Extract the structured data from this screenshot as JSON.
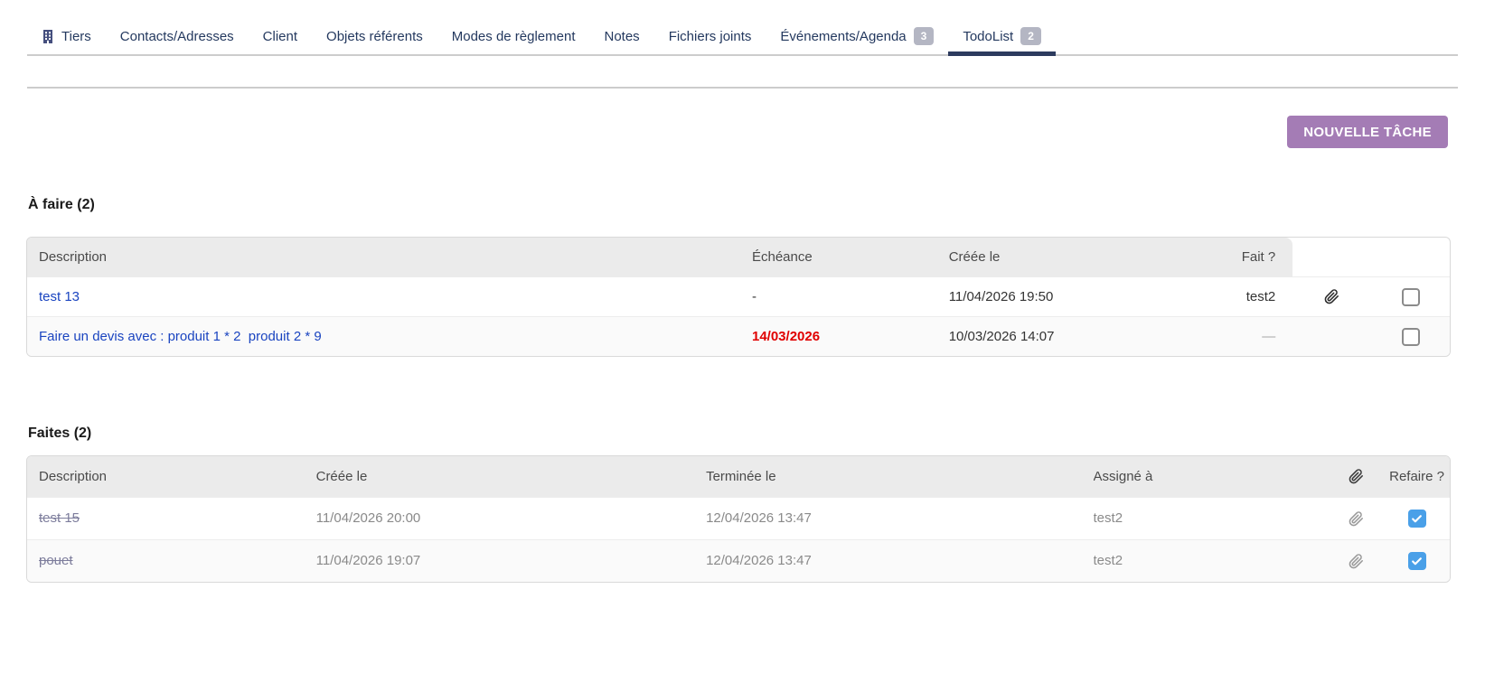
{
  "colors": {
    "tab_navy": "#24395f",
    "active_underline": "#2c3b5e",
    "badge_bg": "#b4b6c3",
    "button_bg": "#a47cb5",
    "link_blue": "#1a44c0",
    "overdue_red": "#e00000",
    "checkbox_blue": "#4aa0e8"
  },
  "tabs": {
    "tiers": "Tiers",
    "contacts": "Contacts/Adresses",
    "client": "Client",
    "objets": "Objets référents",
    "modes": "Modes de règlement",
    "notes": "Notes",
    "fichiers": "Fichiers joints",
    "agenda": "Événements/Agenda",
    "agenda_badge": "3",
    "todolist": "TodoList",
    "todolist_badge": "2"
  },
  "actions": {
    "new_task_label": "NOUVELLE TÂCHE"
  },
  "todo": {
    "title": "À faire (2)",
    "columns": {
      "description": "Description",
      "echeance": "Échéance",
      "creee_le": "Créée le",
      "fait": "Fait ?"
    },
    "rows": [
      {
        "description": "test 13",
        "echeance": "-",
        "creee_le": "11/04/2026 19:50",
        "fait": "test2",
        "has_attachment": true,
        "checked": false
      },
      {
        "description": "Faire un devis avec : produit 1 * 2  produit 2 * 9",
        "echeance": "14/03/2026",
        "creee_le": "10/03/2026 14:07",
        "fait": "—",
        "has_attachment": false,
        "checked": false
      }
    ]
  },
  "done": {
    "title": "Faites (2)",
    "columns": {
      "description": "Description",
      "creee_le": "Créée le",
      "terminee_le": "Terminée le",
      "assigne_a": "Assigné à",
      "refaire": "Refaire ?"
    },
    "rows": [
      {
        "description": "test 15",
        "creee_le": "11/04/2026 20:00",
        "terminee_le": "12/04/2026 13:47",
        "assigne_a": "test2",
        "has_attachment": true,
        "checked": true
      },
      {
        "description": "pouet",
        "creee_le": "11/04/2026 19:07",
        "terminee_le": "12/04/2026 13:47",
        "assigne_a": "test2",
        "has_attachment": true,
        "checked": true
      }
    ]
  }
}
